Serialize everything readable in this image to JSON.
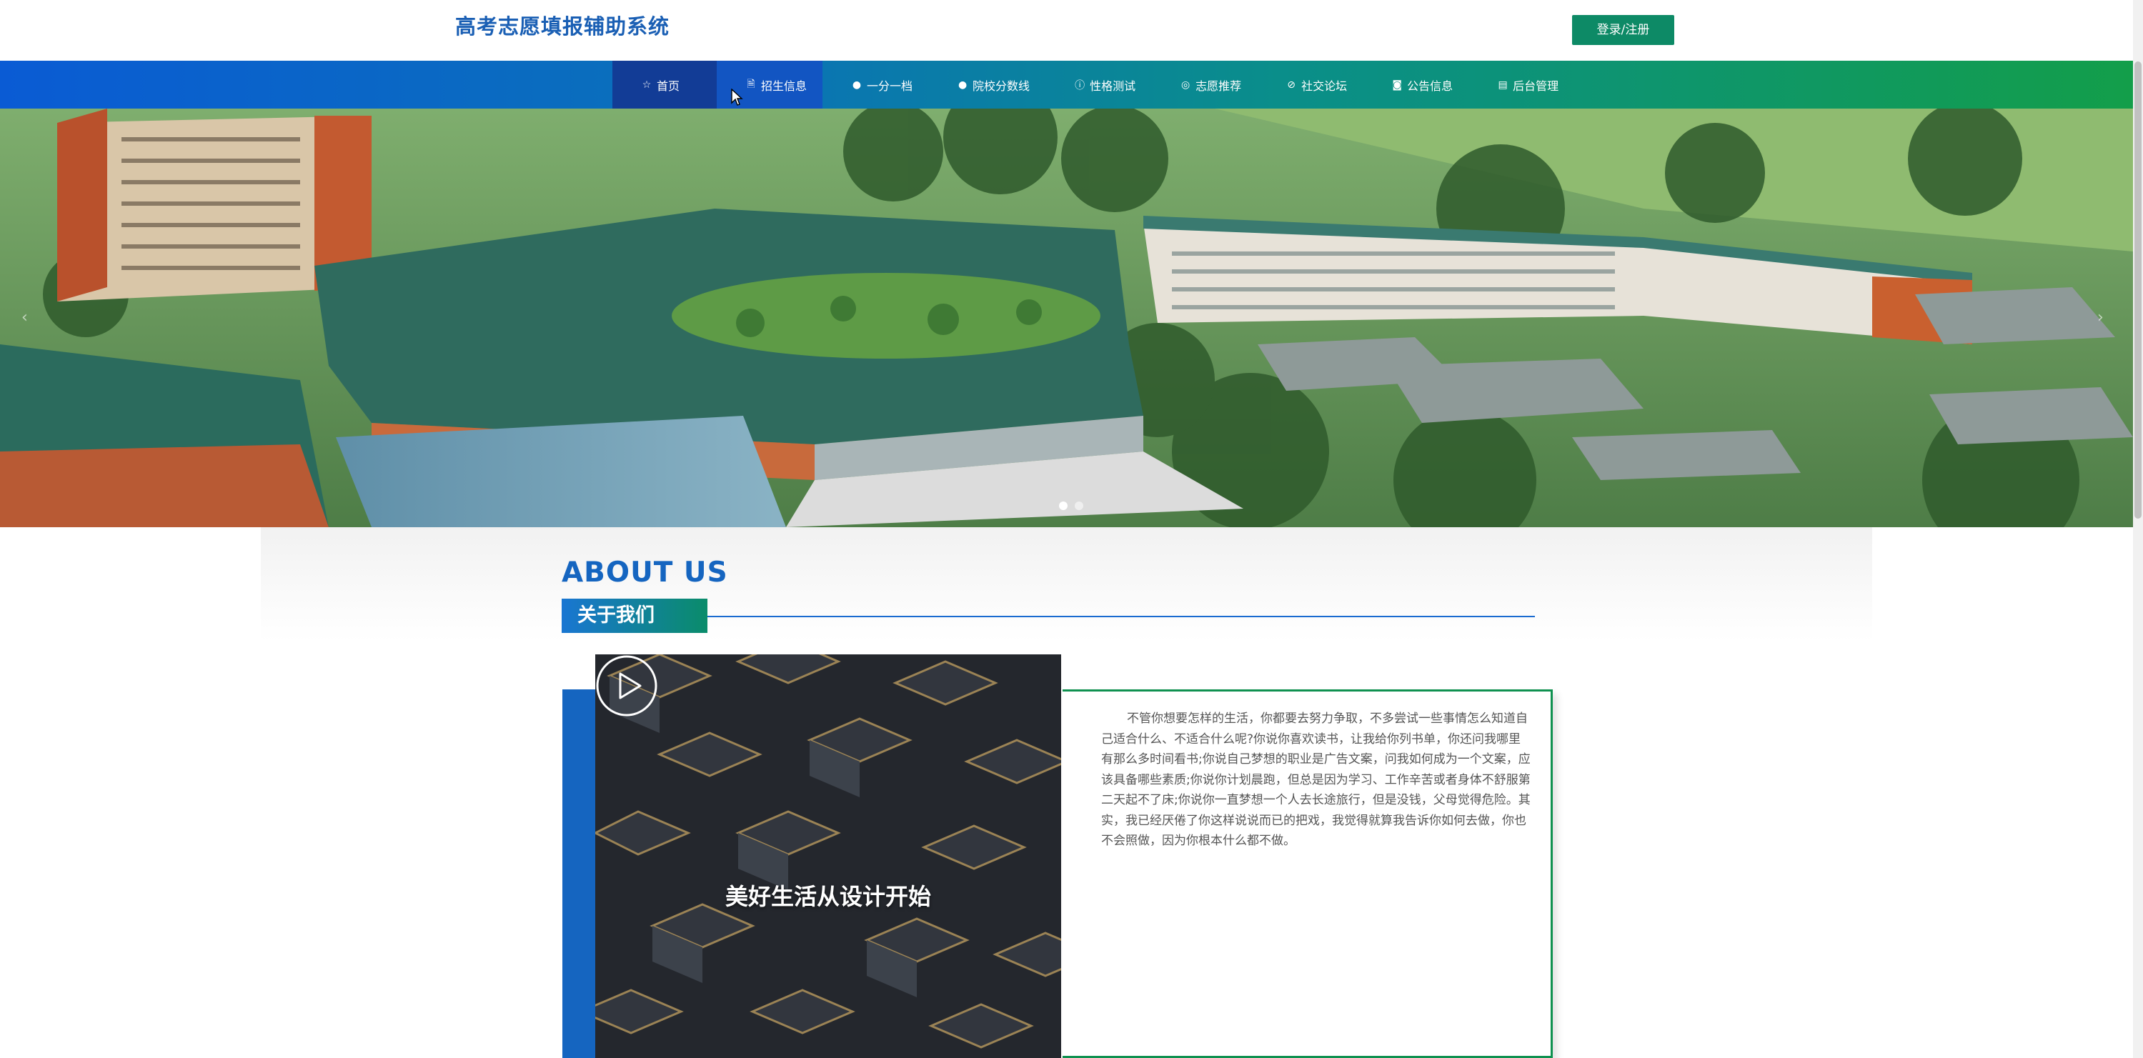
{
  "header": {
    "site_title": "高考志愿填报辅助系统",
    "login_label": "登录/注册"
  },
  "nav": {
    "items": [
      {
        "label": "首页",
        "icon": "star-icon"
      },
      {
        "label": "招生信息",
        "icon": "document-icon"
      },
      {
        "label": "一分一档",
        "icon": "circle-icon"
      },
      {
        "label": "院校分数线",
        "icon": "circle-icon"
      },
      {
        "label": "性格测试",
        "icon": "info-icon"
      },
      {
        "label": "志愿推荐",
        "icon": "target-icon"
      },
      {
        "label": "社交论坛",
        "icon": "compass-icon"
      },
      {
        "label": "公告信息",
        "icon": "camera-icon"
      },
      {
        "label": "后台管理",
        "icon": "clipboard-icon"
      }
    ],
    "active_index": 0,
    "hover_index": 1
  },
  "banner": {
    "slide_count": 2,
    "current_slide": 1
  },
  "about": {
    "title_en": "ABOUT US",
    "title_cn": "关于我们",
    "video_caption": "美好生活从设计开始",
    "text": "不管你想要怎样的生活，你都要去努力争取，不多尝试一些事情怎么知道自己适合什么、不适合什么呢?你说你喜欢读书，让我给你列书单，你还问我哪里有那么多时间看书;你说自己梦想的职业是广告文案，问我如何成为一个文案，应该具备哪些素质;你说你计划晨跑，但总是因为学习、工作辛苦或者身体不舒服第二天起不了床;你说你一直梦想一个人去长途旅行，但是没钱，父母觉得危险。其实，我已经厌倦了你这样说说而已的把戏，我觉得就算我告诉你如何去做，你也不会照做，因为你根本什么都不做。"
  },
  "colors": {
    "brand_blue": "#1565c0",
    "brand_green": "#0f9150",
    "login_bg": "#0d8a66"
  }
}
